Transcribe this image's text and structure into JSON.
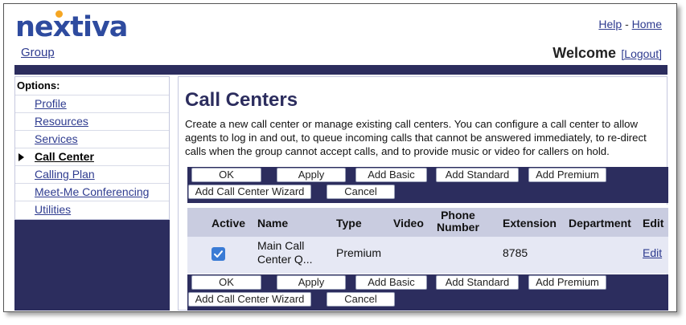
{
  "header": {
    "logo_text": "nextiva",
    "group_link": "Group",
    "help_link": "Help",
    "link_separator": "-",
    "home_link": "Home",
    "welcome": "Welcome",
    "logout_link": "[Logout]"
  },
  "sidebar": {
    "title": "Options:",
    "items": [
      {
        "label": "Profile",
        "active": false
      },
      {
        "label": "Resources",
        "active": false
      },
      {
        "label": "Services",
        "active": false
      },
      {
        "label": "Call Center",
        "active": true
      },
      {
        "label": "Calling Plan",
        "active": false
      },
      {
        "label": "Meet-Me Conferencing",
        "active": false
      },
      {
        "label": "Utilities",
        "active": false
      }
    ]
  },
  "main": {
    "title": "Call Centers",
    "description": "Create a new call center or manage existing call centers. You can configure a call center to allow agents to log in and out, to queue incoming calls that cannot be answered immediately, to re-direct calls when the group cannot accept calls, and to provide music or video for callers on hold."
  },
  "buttons": {
    "ok": "OK",
    "apply": "Apply",
    "add_basic": "Add Basic",
    "add_standard": "Add Standard",
    "add_premium": "Add Premium",
    "wizard": "Add Call Center Wizard",
    "cancel": "Cancel"
  },
  "table": {
    "headers": {
      "active": "Active",
      "name": "Name",
      "type": "Type",
      "video": "Video",
      "phone_line1": "Phone",
      "phone_line2": "Number",
      "extension": "Extension",
      "department": "Department",
      "edit": "Edit"
    },
    "rows": [
      {
        "active": true,
        "name_line1": "Main Call",
        "name_line2": "Center Q...",
        "type": "Premium",
        "video": "",
        "phone": "",
        "extension": "8785",
        "department": "",
        "edit": "Edit"
      }
    ]
  },
  "colors": {
    "brand_blue": "#2e4b9f",
    "navy_bar": "#2c2d5e",
    "logo_dot": "#f5a623",
    "checkbox": "#3a7bd5"
  }
}
